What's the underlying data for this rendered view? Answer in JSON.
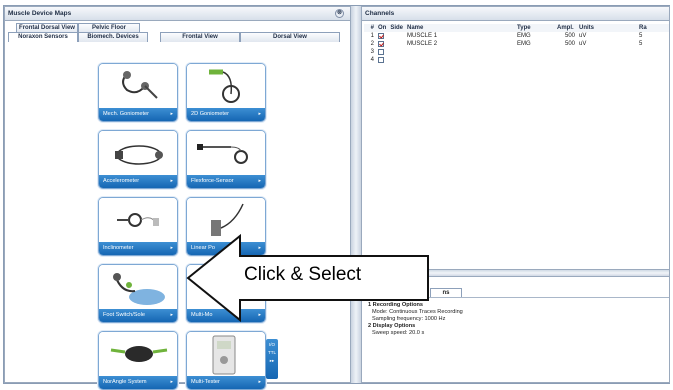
{
  "left_panel": {
    "title": "Muscle Device Maps",
    "close_glyph": "⊗",
    "tabs_row1": [
      "Frontal Dorsal View",
      "Pelvic Floor"
    ],
    "tabs_row2": [
      "Noraxon Sensors",
      "Biomech. Devices",
      "Frontal View",
      "Dorsal View"
    ],
    "active_tab": "Noraxon Sensors",
    "devices": [
      {
        "label": "Mech. Goniometer",
        "icon": "goniometer-icon"
      },
      {
        "label": "2D Goniometer",
        "icon": "2d-goniometer-icon"
      },
      {
        "label": "Accelerometer",
        "icon": "accelerometer-icon"
      },
      {
        "label": "Flexforce-Sensor",
        "icon": "force-sensor-icon"
      },
      {
        "label": "Inclinometer",
        "icon": "inclinometer-icon"
      },
      {
        "label": "Linear Po",
        "icon": "linear-potentiometer-icon"
      },
      {
        "label": "Foot Switch/Sole",
        "icon": "foot-switch-icon"
      },
      {
        "label": "Multi-Mo",
        "icon": "multi-module-icon"
      },
      {
        "label": "NorAngle System",
        "icon": "norangle-icon"
      },
      {
        "label": "Multi-Tester",
        "icon": "multi-tester-icon"
      }
    ],
    "ttl_badge": [
      "I/O",
      "TTL",
      "▸▸"
    ]
  },
  "channels": {
    "title": "Channels",
    "columns": [
      "#",
      "On",
      "Side",
      "Name",
      "Type",
      "Ampl.",
      "Units",
      "Ra"
    ],
    "rows": [
      {
        "num": "1",
        "on": true,
        "side": "",
        "name": "MUSCLE 1",
        "type": "EMG",
        "ampl": "500",
        "units": "uV",
        "ra": "5"
      },
      {
        "num": "2",
        "on": true,
        "side": "",
        "name": "MUSCLE 2",
        "type": "EMG",
        "ampl": "500",
        "units": "uV",
        "ra": "5"
      },
      {
        "num": "3",
        "on": false,
        "side": "",
        "name": "",
        "type": "",
        "ampl": "",
        "units": "",
        "ra": ""
      },
      {
        "num": "4",
        "on": false,
        "side": "",
        "name": "",
        "type": "",
        "ampl": "",
        "units": "",
        "ra": ""
      }
    ]
  },
  "bottom_panel": {
    "tab_label": "ns",
    "sections": [
      {
        "heading": "1 Recording Options",
        "items": [
          "Mode: Continuous Traces Recording",
          "Sampling frequency: 1000 Hz"
        ]
      },
      {
        "heading": "2 Display Options",
        "items": [
          "Sweep speed: 20.0 s"
        ]
      }
    ]
  },
  "callout": {
    "text": "Click & Select"
  },
  "colors": {
    "card_label": "#1566b3",
    "panel_border": "#9aa9bd",
    "check": "#c01818"
  }
}
